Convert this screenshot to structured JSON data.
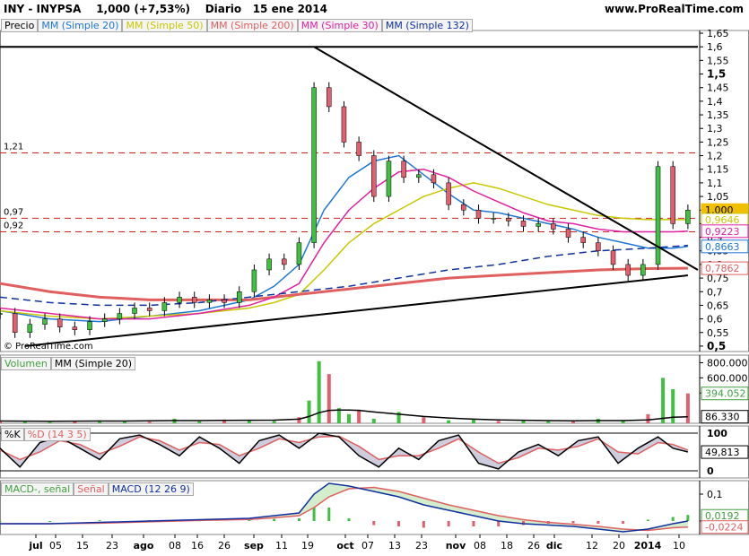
{
  "header": {
    "title": "INY - INYPSA",
    "price_change": "1,000 (+7,53%)",
    "period": "Diario",
    "date": "15 ene 2014",
    "website": "www.ProRealTime.com"
  },
  "copyright": "© ProRealTime.com",
  "legends": {
    "price": [
      {
        "label": "Precio",
        "color": "#000000"
      },
      {
        "label": "MM (Simple 20)",
        "color": "#1f77d4"
      },
      {
        "label": "MM (Simple 50)",
        "color": "#c8c800"
      },
      {
        "label": "MM (Simple 200)",
        "color": "#e06060"
      },
      {
        "label": "MM (Simple 30)",
        "color": "#e020a0"
      },
      {
        "label": "MM (Simple 132)",
        "color": "#1030a0"
      }
    ],
    "volume": [
      {
        "label": "Volumen",
        "color": "#40a040"
      },
      {
        "label": "MM (Simple 20)",
        "color": "#000000"
      }
    ],
    "stoch": [
      {
        "label": "%K",
        "color": "#000000"
      },
      {
        "label": "%D (14 3 5)",
        "color": "#e06060"
      }
    ],
    "macd": [
      {
        "label": "MACD-, señal",
        "color": "#40a040"
      },
      {
        "label": "Señal",
        "color": "#e06060"
      },
      {
        "label": "MACD (12 26 9)",
        "color": "#1030a0"
      }
    ]
  },
  "chart_data": [
    {
      "type": "line",
      "panel": "price",
      "y_ticks": [
        "1,65",
        "1,6",
        "1,55",
        "1,5",
        "1,45",
        "1,4",
        "1,35",
        "1,3",
        "1,25",
        "1,2",
        "1,15",
        "1,1",
        "1,05",
        "1",
        "0,95",
        "0,9",
        "0,85",
        "0,8",
        "0,75",
        "0,7",
        "0,65",
        "0,6",
        "0,55",
        "0,5"
      ],
      "ylim": [
        0.48,
        1.66
      ],
      "x_ticks": [
        "jul",
        "05",
        "15",
        "23",
        "ago",
        "08",
        "16",
        "26",
        "sep",
        "11",
        "19",
        "oct",
        "07",
        "13",
        "23",
        "nov",
        "08",
        "18",
        "26",
        "dic",
        "12",
        "20",
        "2014",
        "10"
      ],
      "reference_lines": [
        {
          "label": "1,21",
          "value": 1.21
        },
        {
          "label": "0,97",
          "value": 0.97
        },
        {
          "label": "0,92",
          "value": 0.92
        }
      ],
      "last_values": [
        {
          "label": "1,000",
          "value": 1.0,
          "color": "#f0c000"
        },
        {
          "label": "0,9646",
          "value": 0.9646,
          "color": "#c8c800"
        },
        {
          "label": "0,9223",
          "value": 0.9223,
          "color": "#e020a0"
        },
        {
          "label": "0,8663",
          "value": 0.8663,
          "color": "#1f77d4"
        },
        {
          "label": "0,7862",
          "value": 0.7862,
          "color": "#e06060"
        }
      ],
      "series": [
        {
          "name": "Precio",
          "x": [
            0,
            3,
            6,
            9,
            12,
            15,
            18,
            21,
            24,
            27,
            30,
            33,
            36,
            39,
            42,
            45,
            48,
            51,
            54,
            57,
            60,
            63,
            66,
            69,
            72,
            75,
            78,
            81,
            84,
            87,
            90,
            93,
            96,
            99,
            102,
            105,
            108,
            111,
            114,
            117,
            120,
            123,
            126,
            129,
            132,
            135,
            138
          ],
          "values": [
            0.62,
            0.55,
            0.58,
            0.6,
            0.57,
            0.56,
            0.59,
            0.6,
            0.62,
            0.64,
            0.63,
            0.66,
            0.68,
            0.66,
            0.67,
            0.66,
            0.7,
            0.78,
            0.82,
            0.8,
            0.88,
            1.45,
            1.38,
            1.25,
            1.2,
            1.05,
            1.18,
            1.12,
            1.13,
            1.1,
            1.02,
            1.0,
            0.97,
            0.97,
            0.96,
            0.94,
            0.95,
            0.93,
            0.9,
            0.88,
            0.85,
            0.8,
            0.76,
            0.8,
            1.16,
            0.95,
            1.0
          ]
        },
        {
          "name": "MM (Simple 20)",
          "x": [
            0,
            10,
            20,
            30,
            40,
            50,
            55,
            60,
            65,
            70,
            75,
            80,
            85,
            90,
            95,
            100,
            105,
            110,
            115,
            120,
            125,
            130,
            135,
            138
          ],
          "values": [
            0.63,
            0.6,
            0.59,
            0.61,
            0.63,
            0.67,
            0.72,
            0.8,
            1.0,
            1.12,
            1.18,
            1.2,
            1.13,
            1.06,
            1.0,
            0.99,
            0.97,
            0.95,
            0.93,
            0.9,
            0.88,
            0.86,
            0.86,
            0.8663
          ]
        },
        {
          "name": "MM (Simple 50)",
          "x": [
            0,
            10,
            20,
            30,
            40,
            50,
            55,
            60,
            65,
            70,
            75,
            80,
            85,
            90,
            95,
            100,
            105,
            110,
            115,
            120,
            125,
            130,
            135,
            138
          ],
          "values": [
            0.63,
            0.61,
            0.6,
            0.61,
            0.62,
            0.64,
            0.66,
            0.69,
            0.78,
            0.88,
            0.95,
            1.0,
            1.05,
            1.08,
            1.1,
            1.08,
            1.05,
            1.02,
            1.0,
            0.98,
            0.97,
            0.965,
            0.965,
            0.9646
          ]
        },
        {
          "name": "MM (Simple 200)",
          "x": [
            0,
            10,
            20,
            30,
            40,
            50,
            60,
            70,
            80,
            90,
            100,
            110,
            120,
            130,
            138
          ],
          "values": [
            0.73,
            0.7,
            0.68,
            0.67,
            0.67,
            0.67,
            0.69,
            0.71,
            0.73,
            0.75,
            0.76,
            0.77,
            0.78,
            0.785,
            0.7862
          ]
        },
        {
          "name": "MM (Simple 30)",
          "x": [
            0,
            10,
            20,
            30,
            40,
            50,
            55,
            60,
            65,
            70,
            75,
            80,
            85,
            90,
            95,
            100,
            105,
            110,
            115,
            120,
            125,
            130,
            135,
            138
          ],
          "values": [
            0.64,
            0.62,
            0.6,
            0.6,
            0.62,
            0.65,
            0.68,
            0.73,
            0.88,
            1.0,
            1.08,
            1.14,
            1.15,
            1.12,
            1.07,
            1.03,
            0.99,
            0.96,
            0.95,
            0.93,
            0.92,
            0.92,
            0.92,
            0.9223
          ]
        },
        {
          "name": "MM (Simple 132)",
          "x": [
            0,
            10,
            20,
            30,
            40,
            50,
            60,
            70,
            80,
            90,
            100,
            110,
            120,
            130,
            138
          ],
          "values": [
            0.68,
            0.66,
            0.65,
            0.65,
            0.66,
            0.68,
            0.7,
            0.72,
            0.75,
            0.78,
            0.8,
            0.83,
            0.85,
            0.86,
            0.87
          ]
        }
      ]
    },
    {
      "type": "bar",
      "panel": "volume",
      "y_ticks": [
        "800.000",
        "600.000",
        "400.000"
      ],
      "ylim": [
        0,
        900000
      ],
      "last_values": [
        {
          "label": "394.052",
          "value": 394052,
          "color": "#40a040"
        },
        {
          "label": "86.330",
          "value": 86330,
          "color": "#000000"
        }
      ],
      "x": [
        0,
        5,
        10,
        15,
        20,
        25,
        30,
        35,
        40,
        45,
        50,
        55,
        60,
        62,
        64,
        66,
        68,
        70,
        72,
        75,
        80,
        85,
        90,
        95,
        100,
        105,
        110,
        115,
        120,
        125,
        130,
        133,
        135,
        138
      ],
      "values": [
        20000,
        30000,
        15000,
        25000,
        40000,
        30000,
        20000,
        60000,
        25000,
        50000,
        40000,
        30000,
        80000,
        300000,
        820000,
        650000,
        200000,
        120000,
        180000,
        60000,
        150000,
        80000,
        40000,
        50000,
        30000,
        40000,
        25000,
        30000,
        60000,
        40000,
        120000,
        600000,
        450000,
        394052
      ],
      "ma_values": [
        30000,
        28000,
        26000,
        28000,
        30000,
        30000,
        32000,
        35000,
        35000,
        38000,
        40000,
        42000,
        55000,
        90000,
        140000,
        170000,
        175000,
        175000,
        170000,
        150000,
        120000,
        90000,
        70000,
        55000,
        45000,
        40000,
        35000,
        33000,
        35000,
        36000,
        45000,
        65000,
        80000,
        86330
      ]
    },
    {
      "type": "line",
      "panel": "stochastic",
      "y_ticks": [
        "100",
        "0"
      ],
      "ylim": [
        0,
        100
      ],
      "last_values": [
        {
          "label": "49,813",
          "value": 49.813,
          "color": "#000000"
        }
      ],
      "series": [
        {
          "name": "%K",
          "x": [
            0,
            4,
            8,
            12,
            16,
            20,
            24,
            28,
            32,
            36,
            40,
            44,
            48,
            52,
            56,
            60,
            64,
            68,
            72,
            76,
            80,
            84,
            88,
            92,
            96,
            100,
            104,
            108,
            112,
            116,
            120,
            124,
            128,
            132,
            135,
            138
          ],
          "values": [
            60,
            10,
            75,
            90,
            60,
            30,
            85,
            95,
            70,
            40,
            90,
            60,
            20,
            80,
            95,
            60,
            100,
            90,
            40,
            10,
            60,
            30,
            80,
            95,
            20,
            5,
            50,
            70,
            40,
            80,
            90,
            20,
            60,
            90,
            60,
            50
          ]
        },
        {
          "name": "%D (14 3 5)",
          "x": [
            0,
            4,
            8,
            12,
            16,
            20,
            24,
            28,
            32,
            36,
            40,
            44,
            48,
            52,
            56,
            60,
            64,
            68,
            72,
            76,
            80,
            84,
            88,
            92,
            96,
            100,
            104,
            108,
            112,
            116,
            120,
            124,
            128,
            132,
            135,
            138
          ],
          "values": [
            55,
            30,
            50,
            80,
            70,
            45,
            65,
            90,
            80,
            55,
            75,
            70,
            40,
            60,
            85,
            75,
            90,
            92,
            65,
            30,
            40,
            40,
            60,
            85,
            50,
            20,
            35,
            60,
            55,
            65,
            85,
            50,
            45,
            75,
            70,
            55
          ]
        }
      ]
    },
    {
      "type": "line",
      "panel": "macd",
      "y_ticks": [
        "0,1",
        "0"
      ],
      "ylim": [
        -0.05,
        0.15
      ],
      "last_values": [
        {
          "label": "0,0192",
          "value": 0.0192,
          "color": "#40a040"
        },
        {
          "label": "-0,0224",
          "value": -0.0224,
          "color": "#e06060"
        }
      ],
      "series": [
        {
          "name": "MACD (12 26 9)",
          "x": [
            0,
            10,
            20,
            30,
            40,
            50,
            55,
            60,
            63,
            66,
            70,
            75,
            80,
            85,
            90,
            95,
            100,
            105,
            110,
            115,
            120,
            125,
            130,
            135,
            138
          ],
          "values": [
            -0.01,
            -0.01,
            -0.005,
            0.0,
            0.005,
            0.01,
            0.02,
            0.03,
            0.1,
            0.14,
            0.13,
            0.11,
            0.09,
            0.06,
            0.04,
            0.02,
            0.0,
            -0.01,
            -0.015,
            -0.02,
            -0.03,
            -0.04,
            -0.03,
            -0.01,
            0.0
          ]
        },
        {
          "name": "Señal",
          "x": [
            0,
            10,
            20,
            30,
            40,
            50,
            55,
            60,
            63,
            66,
            70,
            75,
            80,
            85,
            90,
            95,
            100,
            105,
            110,
            115,
            120,
            125,
            130,
            135,
            138
          ],
          "values": [
            -0.01,
            -0.01,
            -0.008,
            -0.003,
            0.002,
            0.006,
            0.012,
            0.02,
            0.05,
            0.09,
            0.12,
            0.125,
            0.11,
            0.085,
            0.06,
            0.04,
            0.02,
            0.005,
            -0.005,
            -0.012,
            -0.02,
            -0.03,
            -0.035,
            -0.025,
            -0.0224
          ]
        }
      ]
    }
  ]
}
